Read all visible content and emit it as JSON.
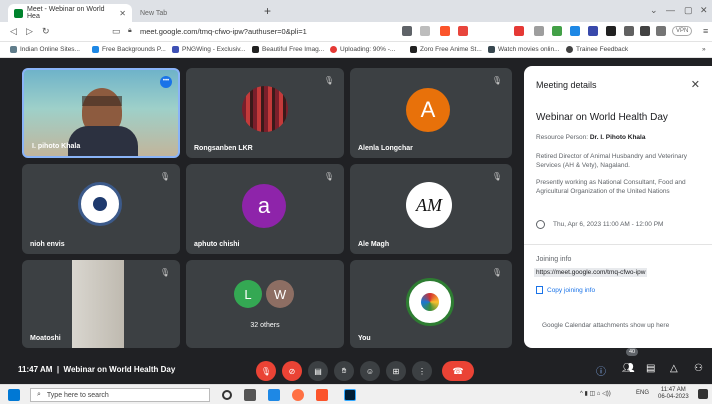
{
  "browser": {
    "active_tab": "Meet - Webinar on World Hea",
    "inactive_tab": "New Tab",
    "url": "meet.google.com/tmq-cfwo-ipw?authuser=0&pli=1",
    "vpn": "VPN",
    "bookmarks": [
      "Indian Online Sites...",
      "Free Backgrounds P...",
      "PNGWing - Exclusiv...",
      "Beautiful Free Imag...",
      "Uploading: 90% -...",
      "Zoro Free Anime St...",
      "Watch movies onlin...",
      "Trainee Feedback"
    ]
  },
  "tiles": {
    "t1": {
      "name": "I. pihoto Khala"
    },
    "t2": {
      "name": "Rongsanben LKR"
    },
    "t3": {
      "name": "Alenla Longchar",
      "initial": "A"
    },
    "t4": {
      "name": "nioh envis"
    },
    "t5": {
      "name": "aphuto chishi",
      "initial": "a"
    },
    "t6": {
      "name": "Ale Magh",
      "mono": "AM"
    },
    "t7": {
      "name": "Moatoshi"
    },
    "t8": {
      "others": "32 others",
      "i1": "L",
      "i2": "W"
    },
    "t9": {
      "name": "You"
    }
  },
  "panel": {
    "title": "Meeting details",
    "event": "Webinar on World Health Day",
    "rp_label": "Resource Person:",
    "rp_name": "Dr. I. Pihoto Khala",
    "desc1": "Retired Director of Animal Husbandry and Veterinary Services (AH & Vety), Nagaland.",
    "desc2": "Presently working as National Consultant, Food and Agricultural Organization of the United Nations",
    "datetime": "Thu, Apr 6, 2023 11:00 AM - 12:00 PM",
    "joining_info": "Joining info",
    "link": "https://meet.google.com/tmq-cfwo-ipw",
    "copy": "Copy joining info",
    "gcal": "Google Calendar attachments show up here"
  },
  "bottom": {
    "time": "11:47 AM",
    "sep": "|",
    "meeting": "Webinar on World Health Day",
    "count": "40"
  },
  "taskbar": {
    "search": "Type here to search",
    "lang": "ENG",
    "clock_time": "11:47 AM",
    "clock_date": "06-04-2023"
  }
}
